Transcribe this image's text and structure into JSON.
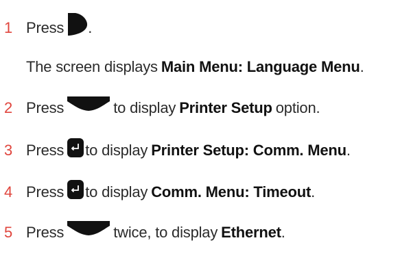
{
  "steps": [
    {
      "number": "1",
      "before": "Press",
      "icon": "play-key-icon",
      "after": "."
    },
    {
      "note_before": "The screen displays",
      "note_bold": "Main Menu: Language Menu",
      "note_after": "."
    },
    {
      "number": "2",
      "before": "Press",
      "icon": "down-key-icon",
      "after": "to display",
      "bold": "Printer Setup",
      "tail": "option."
    },
    {
      "number": "3",
      "before": "Press",
      "icon": "enter-key-icon",
      "after": "to display",
      "bold": "Printer Setup: Comm. Menu",
      "tail": "."
    },
    {
      "number": "4",
      "before": "Press",
      "icon": "enter-key-icon",
      "after": "to display",
      "bold": "Comm. Menu: Timeout",
      "tail": "."
    },
    {
      "number": "5",
      "before": "Press",
      "icon": "down-key-icon",
      "after": "twice, to display",
      "bold": "Ethernet",
      "tail": "."
    }
  ],
  "colors": {
    "step_number": "#e0453d",
    "text": "#2b2b2b",
    "icon": "#111111"
  }
}
